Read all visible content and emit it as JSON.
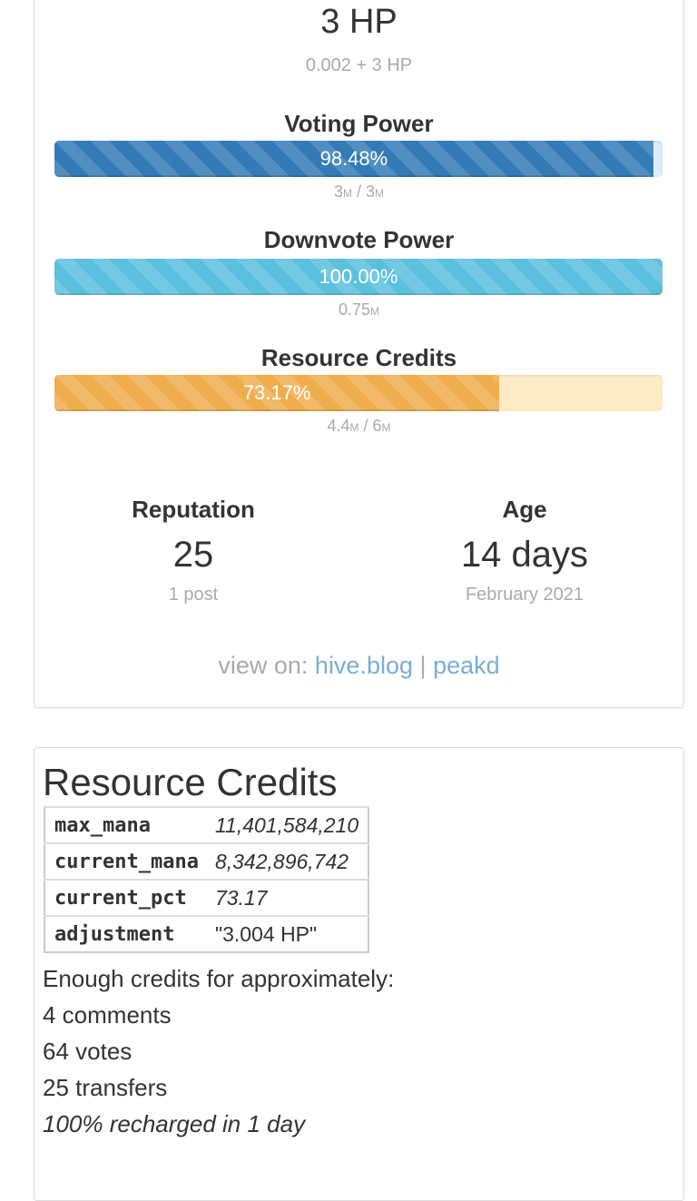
{
  "hive_power": {
    "value": "3 HP",
    "breakdown": "0.002 + 3 HP"
  },
  "voting_power": {
    "title": "Voting Power",
    "percent_label": "98.48%",
    "fill_fraction": 0.9848,
    "current": "3",
    "current_unit": "M",
    "max": "3",
    "max_unit": "M",
    "color": "#337ab7"
  },
  "downvote_power": {
    "title": "Downvote Power",
    "percent_label": "100.00%",
    "fill_fraction": 1.0,
    "current": "0.75",
    "current_unit": "M",
    "color": "#5bc0de"
  },
  "resource_credits_meter": {
    "title": "Resource Credits",
    "percent_label": "73.17%",
    "fill_fraction": 0.7317,
    "current": "4.4",
    "current_unit": "M",
    "max": "6",
    "max_unit": "M",
    "color": "#f0ad4e"
  },
  "reputation": {
    "title": "Reputation",
    "value": "25",
    "sub": "1 post"
  },
  "age": {
    "title": "Age",
    "value": "14 days",
    "sub": "February 2021"
  },
  "view_on": {
    "label": "view on:",
    "link1": "hive.blog",
    "separator": "|",
    "link2": "peakd"
  },
  "rc_panel": {
    "heading": "Resource Credits",
    "rows": [
      {
        "key": "max_mana",
        "value": "11,401,584,210"
      },
      {
        "key": "current_mana",
        "value": "8,342,896,742"
      },
      {
        "key": "current_pct",
        "value": "73.17"
      },
      {
        "key": "adjustment",
        "value": "\"3.004 HP\""
      }
    ],
    "enough_label": "Enough credits for approximately:",
    "comments": "4 comments",
    "votes": "64 votes",
    "transfers": "25 transfers",
    "recharge": "100% recharged in 1 day"
  }
}
